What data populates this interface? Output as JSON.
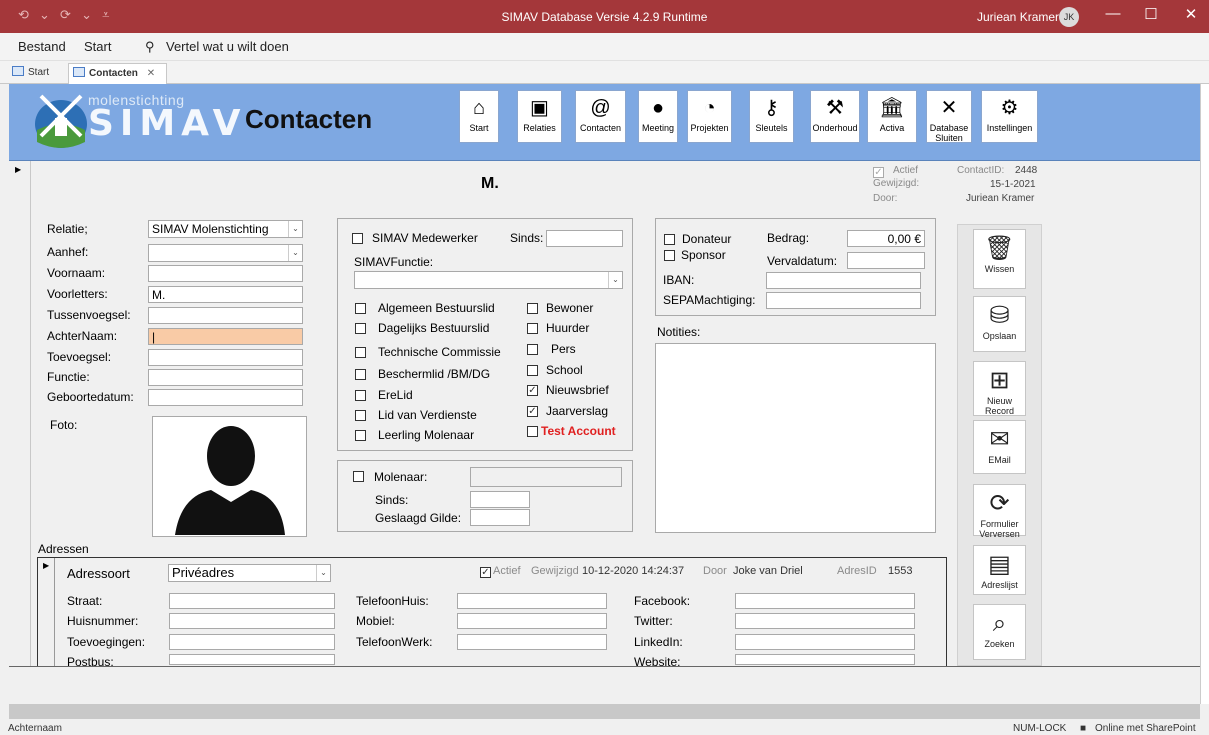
{
  "titlebar": {
    "quickaccess": "⟲ ⌄ ⟳ ⌄ ⩡",
    "title": "SIMAV Database Versie 4.2.9 Runtime",
    "user": "Juriean Kramer",
    "initials": "JK"
  },
  "ribbon": {
    "bestand": "Bestand",
    "start": "Start",
    "tell": "Vertel wat u wilt doen"
  },
  "doctabs": {
    "start": "Start",
    "contacten": "Contacten"
  },
  "header": {
    "logo_sub": "molenstichting",
    "logo_main": "SIMAV",
    "title": "Contacten",
    "nav": [
      {
        "label": "Start",
        "icon": "home-icon",
        "glyph": "⌂"
      },
      {
        "label": "Relaties",
        "icon": "id-card-icon",
        "glyph": "▣"
      },
      {
        "label": "Contacten",
        "icon": "address-book-icon",
        "glyph": "@"
      },
      {
        "label": "Meeting",
        "icon": "group-icon",
        "glyph": "●"
      },
      {
        "label": "Projekten",
        "icon": "pie-icon",
        "glyph": "◔"
      },
      {
        "label": "Sleutels",
        "icon": "key-icon",
        "glyph": "⚷"
      },
      {
        "label": "Onderhoud",
        "icon": "tools-icon",
        "glyph": "⚒"
      },
      {
        "label": "Activa",
        "icon": "bank-icon",
        "glyph": "🏛"
      },
      {
        "label": "Database Sluiten",
        "icon": "close-icon",
        "glyph": "✕"
      },
      {
        "label": "Instellingen",
        "icon": "gear-icon",
        "glyph": "⚙"
      }
    ]
  },
  "record": {
    "name": "M.",
    "actief": "Actief",
    "gewijzigd": "Gewijzigd:",
    "door": "Door:",
    "contactid_label": "ContactID:",
    "contactid": "2448",
    "date": "15-1-2021",
    "author": "Juriean Kramer"
  },
  "person": {
    "relatie_label": "Relatie;",
    "relatie": "SIMAV Molenstichting",
    "aanhef_label": "Aanhef:",
    "voornaam_label": "Voornaam:",
    "voorletters_label": "Voorletters:",
    "voorletters": "M.",
    "tussen_label": "Tussenvoegsel:",
    "achter_label": "AchterNaam:",
    "toevoeg_label": "Toevoegsel:",
    "functie_label": "Functie:",
    "geboorte_label": "Geboortedatum:",
    "foto_label": "Foto:"
  },
  "simav": {
    "medewerker": "SIMAV Medewerker",
    "sinds": "Sinds:",
    "functie": "SIMAVFunctie:",
    "left": [
      "Algemeen Bestuurslid",
      "Dagelijks Bestuurslid",
      "Technische Commissie",
      "Beschermlid /BM/DG",
      "EreLid",
      "Lid van Verdienste",
      "Leerling Molenaar"
    ],
    "right": [
      "Bewoner",
      "Huurder",
      "Pers",
      "School",
      "Nieuwsbrief",
      "Jaarverslag"
    ],
    "test": "Test Account"
  },
  "molenaar": {
    "label": "Molenaar:",
    "sinds": "Sinds:",
    "gilde": "Geslaagd Gilde:"
  },
  "donateur": {
    "donateur": "Donateur",
    "sponsor": "Sponsor",
    "bedrag": "Bedrag:",
    "bedrag_val": "0,00 €",
    "verval": "Vervaldatum:",
    "iban": "IBAN:",
    "sepa": "SEPAMachtiging:",
    "notities": "Notities:"
  },
  "sidebar": [
    {
      "label": "Wissen",
      "icon": "trash-icon",
      "glyph": "🗑"
    },
    {
      "label": "Opslaan",
      "icon": "database-icon",
      "glyph": "⛁"
    },
    {
      "label": "Nieuw Record",
      "icon": "new-record-icon",
      "glyph": "⊞"
    },
    {
      "label": "EMail",
      "icon": "mail-icon",
      "glyph": "✉"
    },
    {
      "label": "Formulier Verversen",
      "icon": "refresh-icon",
      "glyph": "⟳"
    },
    {
      "label": "Adreslijst",
      "icon": "list-icon",
      "glyph": "▤"
    },
    {
      "label": "Zoeken",
      "icon": "search-icon",
      "glyph": "⌕"
    }
  ],
  "adressen": {
    "title": "Adressen",
    "soort_label": "Adressoort",
    "soort": "Privéadres",
    "actief": "Actief",
    "gewijzigd": "Gewijzigd",
    "datum": "10-12-2020 14:24:37",
    "door": "Door",
    "door_val": "Joke van Driel",
    "adresid": "AdresID",
    "adresid_val": "1553",
    "col1": [
      "Straat:",
      "Huisnummer:",
      "Toevoegingen:",
      "Postbus:"
    ],
    "col2": [
      "TelefoonHuis:",
      "Mobiel:",
      "TelefoonWerk:"
    ],
    "col3": [
      "Facebook:",
      "Twitter:",
      "LinkedIn:",
      "Website:"
    ]
  },
  "status": {
    "left": "Achternaam",
    "numlock": "NUM-LOCK",
    "online": "Online met SharePoint"
  }
}
